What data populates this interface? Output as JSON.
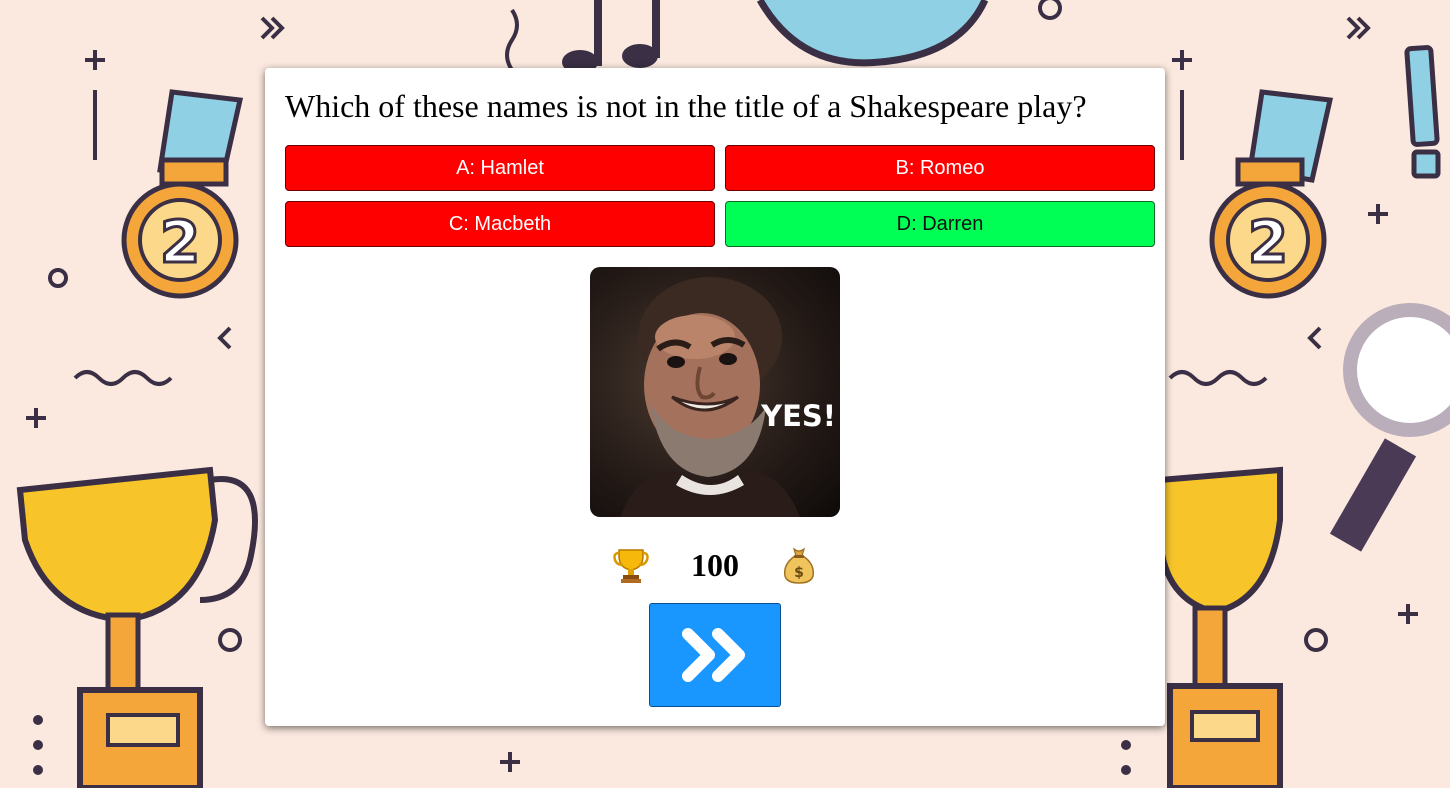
{
  "question": {
    "text": "Which of these names is not in the title of a Shakespeare play?"
  },
  "answers": [
    {
      "label": "A: Hamlet",
      "status": "wrong",
      "color": "#ff0000"
    },
    {
      "label": "B: Romeo",
      "status": "wrong",
      "color": "#ff0000"
    },
    {
      "label": "C: Macbeth",
      "status": "wrong",
      "color": "#ff0000"
    },
    {
      "label": "D: Darren",
      "status": "correct",
      "color": "#00ff55"
    }
  ],
  "reaction": {
    "caption": "YES!"
  },
  "score": {
    "value": "100",
    "left_icon": "trophy-icon",
    "right_icon": "money-bag-icon"
  },
  "next": {
    "icon": "double-chevron-right-icon",
    "color": "#1a97ff"
  },
  "colors": {
    "background": "#fbe9df",
    "card": "#ffffff"
  }
}
